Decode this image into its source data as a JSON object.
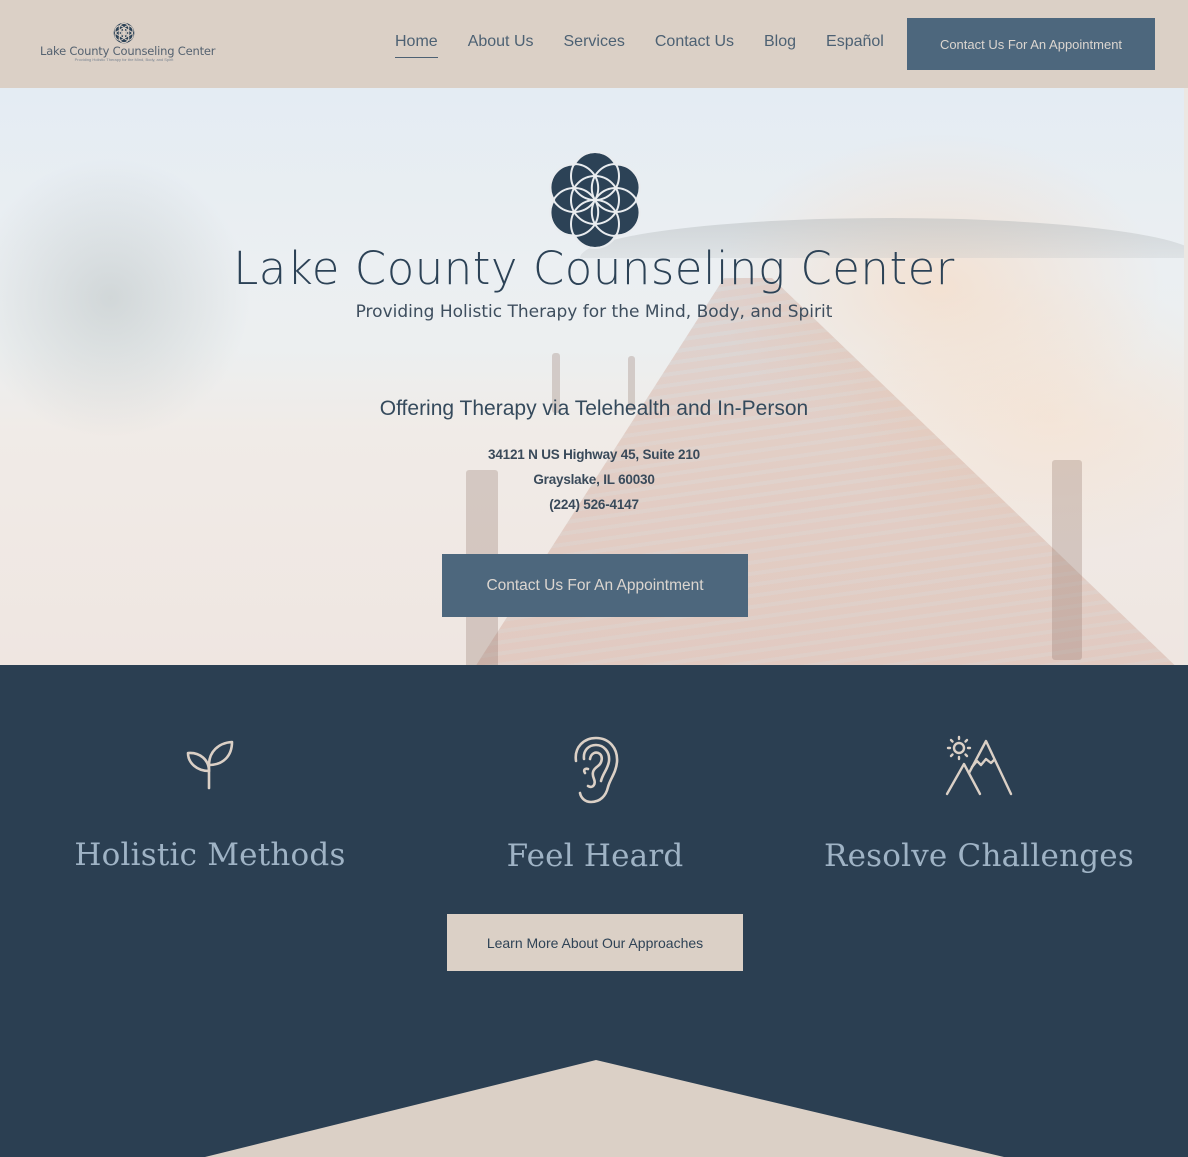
{
  "header": {
    "logo": {
      "title": "Lake County Counseling Center",
      "tagline": "Providing Holistic Therapy for the Mind, Body, and Spirit"
    },
    "nav": [
      {
        "label": "Home",
        "active": true
      },
      {
        "label": "About Us",
        "active": false
      },
      {
        "label": "Services",
        "active": false
      },
      {
        "label": "Contact Us",
        "active": false
      },
      {
        "label": "Blog",
        "active": false
      },
      {
        "label": "Español",
        "active": false
      }
    ],
    "cta_label": "Contact Us For An Appointment"
  },
  "hero": {
    "logo_icon": "seed-of-life-icon",
    "title": "Lake County Counseling Center",
    "subtitle": "Providing Holistic Therapy for the Mind, Body, and Spirit",
    "offering": "Offering Therapy via Telehealth and In-Person",
    "address_line1": "34121 N US Highway 45,  Suite 210",
    "address_line2": "Grayslake, IL 60030",
    "phone": "(224) 526-4147",
    "cta_label": "Contact Us For An Appointment"
  },
  "features": {
    "items": [
      {
        "icon": "sprout-icon",
        "title": "Holistic Methods"
      },
      {
        "icon": "ear-icon",
        "title": "Feel Heard"
      },
      {
        "icon": "mountain-sun-icon",
        "title": "Resolve Challenges"
      }
    ],
    "button_label": "Learn More About Our Approaches"
  },
  "colors": {
    "header_bg": "#dbd0c6",
    "navy": "#2b3f52",
    "button_blue": "#4d677d",
    "heading_light_blue": "#9fb3c5",
    "beige": "#dbd0c6"
  }
}
